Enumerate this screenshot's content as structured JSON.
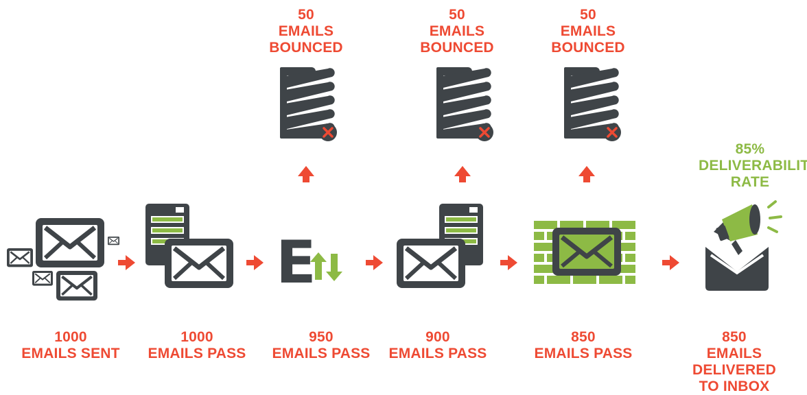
{
  "colors": {
    "accent_red": "#ee4a33",
    "accent_green": "#8dba45",
    "icon_dark": "#3f4448"
  },
  "bounces": [
    {
      "count": "50",
      "line1": "EMAILS",
      "line2": "BOUNCED"
    },
    {
      "count": "50",
      "line1": "EMAILS",
      "line2": "BOUNCED"
    },
    {
      "count": "50",
      "line1": "EMAILS",
      "line2": "BOUNCED"
    }
  ],
  "stages": [
    {
      "count": "1000",
      "line1": "EMAILS SENT",
      "icon": "emails-sent-icon"
    },
    {
      "count": "1000",
      "line1": "EMAILS PASS",
      "icon": "server-envelope-icon"
    },
    {
      "count": "950",
      "line1": "EMAILS PASS",
      "icon": "exchange-arrows-icon"
    },
    {
      "count": "900",
      "line1": "EMAILS PASS",
      "icon": "envelope-server-icon"
    },
    {
      "count": "850",
      "line1": "EMAILS PASS",
      "icon": "firewall-envelope-icon"
    },
    {
      "count": "850",
      "line1": "EMAILS DELIVERED",
      "line2": "TO INBOX",
      "icon": "inbox-megaphone-icon"
    }
  ],
  "rate": {
    "percent": "85%",
    "line1": "DELIVERABILITY",
    "line2": "RATE"
  },
  "e_letter": "E"
}
